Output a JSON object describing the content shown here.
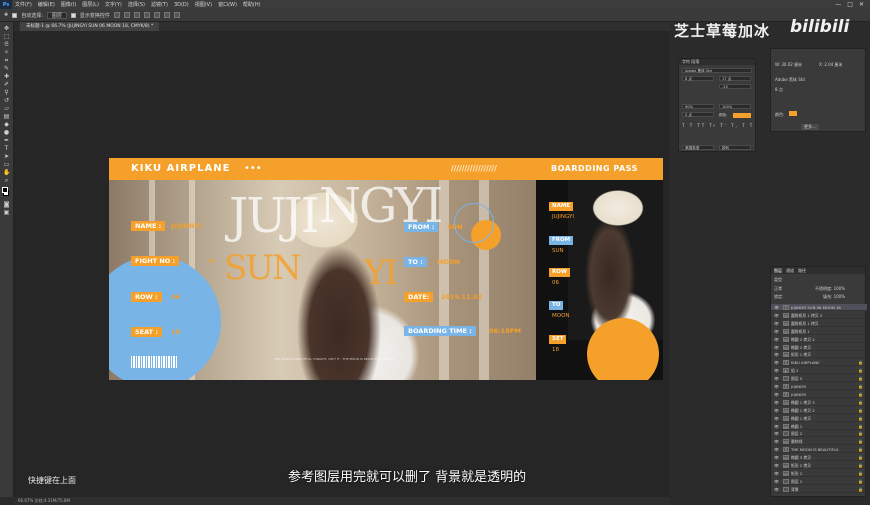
{
  "menu": {
    "logo": "Ps",
    "items": [
      "文件(F)",
      "编辑(E)",
      "图像(I)",
      "图层(L)",
      "文字(Y)",
      "选择(S)",
      "滤镜(T)",
      "3D(D)",
      "视图(V)",
      "窗口(W)",
      "帮助(H)"
    ],
    "window_controls": [
      "—",
      "□",
      "✕"
    ]
  },
  "options": {
    "auto_select_label": "自动选择:",
    "auto_select_value": "图层",
    "show_transform_label": "显示变换控件"
  },
  "document_tab": {
    "title": "未标题-1 @ 66.7% (JUJINGYI SUN 06 MOON 18, CMYK/8) *"
  },
  "ticket": {
    "brand": "KIKU AIRPLANE",
    "dots": "•••",
    "slashes": "/////////////////",
    "boarding_pass": "BOARDDING PASS",
    "big_text_1": "JUJI",
    "big_text_2": "NGYI",
    "big_text_3": "SUN",
    "big_text_4": "YI",
    "name_label": "NAME :",
    "name_value": "JUJINGYI",
    "flight_label": "FIGHT NO :",
    "flight_value": "4",
    "row_label": "ROW :",
    "row_value": "06",
    "seat_label": "SEAT :",
    "seat_value": "18",
    "from_label": "FROM :",
    "from_value": "SUN",
    "to_label": "TO :",
    "to_value": "MOON",
    "date_label": "DATE:",
    "date_value": "2019.11.02",
    "boarding_time_label": "BOARDING TIME :",
    "boarding_time_value": "06:18PM",
    "microtext": "THE MOON IS BEAUTIFUL TONIGHT, ISN'T IT · THE MOON IS BEAUTIFUL TONIGHT",
    "side": {
      "name_label": "NAME",
      "name_value": "JUJINGYI",
      "from_label": "FROM",
      "from_value": "SUN",
      "row_label": "ROW",
      "row_value": "06",
      "to_label": "TO",
      "to_value": "MOON",
      "set_label": "SET",
      "set_value": "18"
    }
  },
  "watermark": {
    "text": "芝士草莓加冰",
    "bili": "bilibili"
  },
  "character_panel": {
    "tabs": "字符   段落",
    "font": "Adobe 黑体 Std",
    "size": "8 点",
    "leading": "17 点",
    "tracking": "-20",
    "scale_v": "90%",
    "scale_h": "100%",
    "baseline": "0 点",
    "color_label": "颜色:",
    "language": "美国英语",
    "aa": "锐利"
  },
  "properties_panel": {
    "w": "W: 30.02 厘米",
    "x": "X: 2.04 厘米",
    "font": "Adobe 黑体 Std",
    "size": "8 点",
    "color_label": "颜色:",
    "button": "更多..."
  },
  "layers": {
    "tabs": [
      "图层",
      "通道",
      "路径"
    ],
    "kind": "类型",
    "blend": "正常",
    "opacity": "不透明度: 100%",
    "lock": "锁定:",
    "fill": "填充: 100%",
    "items": [
      {
        "name": "JUJINGYI SUN 06 MOON 18",
        "type": "text"
      },
      {
        "name": "圆角矩形 1 拷贝 2",
        "type": "shape"
      },
      {
        "name": "圆角矩形 1 拷贝",
        "type": "shape"
      },
      {
        "name": "圆角矩形 1",
        "type": "shape"
      },
      {
        "name": "椭圆 2 拷贝 2",
        "type": "shape"
      },
      {
        "name": "椭圆 2 拷贝",
        "type": "shape"
      },
      {
        "name": "矩形 1 拷贝",
        "type": "shape"
      },
      {
        "name": "KIKU AIRPLANE",
        "type": "text"
      },
      {
        "name": "组 2",
        "type": "group"
      },
      {
        "name": "图层 5",
        "type": "pixel"
      },
      {
        "name": "JUJINGYI",
        "type": "text"
      },
      {
        "name": "JUJINGYI",
        "type": "text"
      },
      {
        "name": "椭圆 1 拷贝 3",
        "type": "shape"
      },
      {
        "name": "椭圆 1 拷贝 2",
        "type": "shape"
      },
      {
        "name": "椭圆 1 拷贝",
        "type": "shape"
      },
      {
        "name": "椭圆 1",
        "type": "shape"
      },
      {
        "name": "图层 2",
        "type": "pixel"
      },
      {
        "name": "删除线",
        "type": "shape"
      },
      {
        "name": "THE MOON IS BEAUTIFUL",
        "type": "text"
      },
      {
        "name": "椭圆 3 拷贝",
        "type": "shape"
      },
      {
        "name": "矩形 2 拷贝",
        "type": "shape"
      },
      {
        "name": "矩形 2",
        "type": "shape"
      },
      {
        "name": "图层 1",
        "type": "pixel"
      },
      {
        "name": "背景",
        "type": "pixel"
      }
    ]
  },
  "status": {
    "text": "66.67%    文档:4.31M/75.8M"
  },
  "subtitle": {
    "text": "参考图层用完就可以删了 背景就是透明的"
  },
  "hint": {
    "text": "快捷键在上面"
  },
  "colors": {
    "accent": "#f5a02a",
    "blue": "#78b4e6"
  }
}
